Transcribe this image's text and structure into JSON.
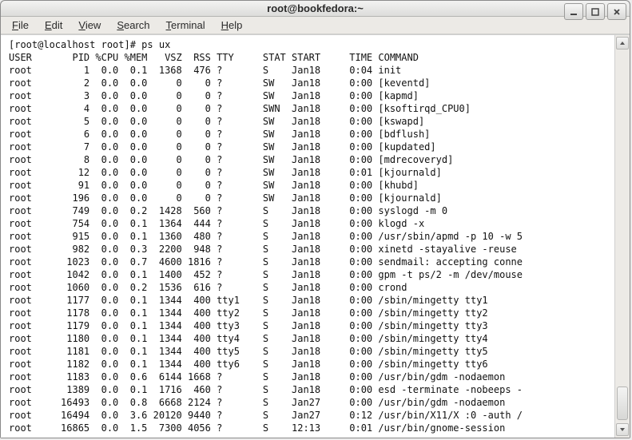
{
  "window": {
    "title": "root@bookfedora:~"
  },
  "menu": {
    "items": [
      {
        "u": "F",
        "rest": "ile"
      },
      {
        "u": "E",
        "rest": "dit"
      },
      {
        "u": "V",
        "rest": "iew"
      },
      {
        "u": "S",
        "rest": "earch"
      },
      {
        "u": "T",
        "rest": "erminal"
      },
      {
        "u": "H",
        "rest": "elp"
      }
    ]
  },
  "terminal": {
    "prompt": "[root@localhost root]# ",
    "cmd": "ps ux",
    "header": [
      "USER",
      "PID",
      "%CPU",
      "%MEM",
      "VSZ",
      "RSS",
      "TTY",
      "STAT",
      "START",
      "TIME",
      "COMMAND"
    ],
    "rows": [
      {
        "user": "root",
        "pid": "1",
        "cpu": "0.0",
        "mem": "0.1",
        "vsz": "1368",
        "rss": "476",
        "tty": "?",
        "stat": "S",
        "start": "Jan18",
        "time": "0:04",
        "cmd": "init"
      },
      {
        "user": "root",
        "pid": "2",
        "cpu": "0.0",
        "mem": "0.0",
        "vsz": "0",
        "rss": "0",
        "tty": "?",
        "stat": "SW",
        "start": "Jan18",
        "time": "0:00",
        "cmd": "[keventd]"
      },
      {
        "user": "root",
        "pid": "3",
        "cpu": "0.0",
        "mem": "0.0",
        "vsz": "0",
        "rss": "0",
        "tty": "?",
        "stat": "SW",
        "start": "Jan18",
        "time": "0:00",
        "cmd": "[kapmd]"
      },
      {
        "user": "root",
        "pid": "4",
        "cpu": "0.0",
        "mem": "0.0",
        "vsz": "0",
        "rss": "0",
        "tty": "?",
        "stat": "SWN",
        "start": "Jan18",
        "time": "0:00",
        "cmd": "[ksoftirqd_CPU0]"
      },
      {
        "user": "root",
        "pid": "5",
        "cpu": "0.0",
        "mem": "0.0",
        "vsz": "0",
        "rss": "0",
        "tty": "?",
        "stat": "SW",
        "start": "Jan18",
        "time": "0:00",
        "cmd": "[kswapd]"
      },
      {
        "user": "root",
        "pid": "6",
        "cpu": "0.0",
        "mem": "0.0",
        "vsz": "0",
        "rss": "0",
        "tty": "?",
        "stat": "SW",
        "start": "Jan18",
        "time": "0:00",
        "cmd": "[bdflush]"
      },
      {
        "user": "root",
        "pid": "7",
        "cpu": "0.0",
        "mem": "0.0",
        "vsz": "0",
        "rss": "0",
        "tty": "?",
        "stat": "SW",
        "start": "Jan18",
        "time": "0:00",
        "cmd": "[kupdated]"
      },
      {
        "user": "root",
        "pid": "8",
        "cpu": "0.0",
        "mem": "0.0",
        "vsz": "0",
        "rss": "0",
        "tty": "?",
        "stat": "SW",
        "start": "Jan18",
        "time": "0:00",
        "cmd": "[mdrecoveryd]"
      },
      {
        "user": "root",
        "pid": "12",
        "cpu": "0.0",
        "mem": "0.0",
        "vsz": "0",
        "rss": "0",
        "tty": "?",
        "stat": "SW",
        "start": "Jan18",
        "time": "0:01",
        "cmd": "[kjournald]"
      },
      {
        "user": "root",
        "pid": "91",
        "cpu": "0.0",
        "mem": "0.0",
        "vsz": "0",
        "rss": "0",
        "tty": "?",
        "stat": "SW",
        "start": "Jan18",
        "time": "0:00",
        "cmd": "[khubd]"
      },
      {
        "user": "root",
        "pid": "196",
        "cpu": "0.0",
        "mem": "0.0",
        "vsz": "0",
        "rss": "0",
        "tty": "?",
        "stat": "SW",
        "start": "Jan18",
        "time": "0:00",
        "cmd": "[kjournald]"
      },
      {
        "user": "root",
        "pid": "749",
        "cpu": "0.0",
        "mem": "0.2",
        "vsz": "1428",
        "rss": "560",
        "tty": "?",
        "stat": "S",
        "start": "Jan18",
        "time": "0:00",
        "cmd": "syslogd -m 0"
      },
      {
        "user": "root",
        "pid": "754",
        "cpu": "0.0",
        "mem": "0.1",
        "vsz": "1364",
        "rss": "444",
        "tty": "?",
        "stat": "S",
        "start": "Jan18",
        "time": "0:00",
        "cmd": "klogd -x"
      },
      {
        "user": "root",
        "pid": "915",
        "cpu": "0.0",
        "mem": "0.1",
        "vsz": "1360",
        "rss": "480",
        "tty": "?",
        "stat": "S",
        "start": "Jan18",
        "time": "0:00",
        "cmd": "/usr/sbin/apmd -p 10 -w 5"
      },
      {
        "user": "root",
        "pid": "982",
        "cpu": "0.0",
        "mem": "0.3",
        "vsz": "2200",
        "rss": "948",
        "tty": "?",
        "stat": "S",
        "start": "Jan18",
        "time": "0:00",
        "cmd": "xinetd -stayalive -reuse"
      },
      {
        "user": "root",
        "pid": "1023",
        "cpu": "0.0",
        "mem": "0.7",
        "vsz": "4600",
        "rss": "1816",
        "tty": "?",
        "stat": "S",
        "start": "Jan18",
        "time": "0:00",
        "cmd": "sendmail: accepting conne"
      },
      {
        "user": "root",
        "pid": "1042",
        "cpu": "0.0",
        "mem": "0.1",
        "vsz": "1400",
        "rss": "452",
        "tty": "?",
        "stat": "S",
        "start": "Jan18",
        "time": "0:00",
        "cmd": "gpm -t ps/2 -m /dev/mouse"
      },
      {
        "user": "root",
        "pid": "1060",
        "cpu": "0.0",
        "mem": "0.2",
        "vsz": "1536",
        "rss": "616",
        "tty": "?",
        "stat": "S",
        "start": "Jan18",
        "time": "0:00",
        "cmd": "crond"
      },
      {
        "user": "root",
        "pid": "1177",
        "cpu": "0.0",
        "mem": "0.1",
        "vsz": "1344",
        "rss": "400",
        "tty": "tty1",
        "stat": "S",
        "start": "Jan18",
        "time": "0:00",
        "cmd": "/sbin/mingetty tty1"
      },
      {
        "user": "root",
        "pid": "1178",
        "cpu": "0.0",
        "mem": "0.1",
        "vsz": "1344",
        "rss": "400",
        "tty": "tty2",
        "stat": "S",
        "start": "Jan18",
        "time": "0:00",
        "cmd": "/sbin/mingetty tty2"
      },
      {
        "user": "root",
        "pid": "1179",
        "cpu": "0.0",
        "mem": "0.1",
        "vsz": "1344",
        "rss": "400",
        "tty": "tty3",
        "stat": "S",
        "start": "Jan18",
        "time": "0:00",
        "cmd": "/sbin/mingetty tty3"
      },
      {
        "user": "root",
        "pid": "1180",
        "cpu": "0.0",
        "mem": "0.1",
        "vsz": "1344",
        "rss": "400",
        "tty": "tty4",
        "stat": "S",
        "start": "Jan18",
        "time": "0:00",
        "cmd": "/sbin/mingetty tty4"
      },
      {
        "user": "root",
        "pid": "1181",
        "cpu": "0.0",
        "mem": "0.1",
        "vsz": "1344",
        "rss": "400",
        "tty": "tty5",
        "stat": "S",
        "start": "Jan18",
        "time": "0:00",
        "cmd": "/sbin/mingetty tty5"
      },
      {
        "user": "root",
        "pid": "1182",
        "cpu": "0.0",
        "mem": "0.1",
        "vsz": "1344",
        "rss": "400",
        "tty": "tty6",
        "stat": "S",
        "start": "Jan18",
        "time": "0:00",
        "cmd": "/sbin/mingetty tty6"
      },
      {
        "user": "root",
        "pid": "1183",
        "cpu": "0.0",
        "mem": "0.6",
        "vsz": "6144",
        "rss": "1668",
        "tty": "?",
        "stat": "S",
        "start": "Jan18",
        "time": "0:00",
        "cmd": "/usr/bin/gdm -nodaemon"
      },
      {
        "user": "root",
        "pid": "1389",
        "cpu": "0.0",
        "mem": "0.1",
        "vsz": "1716",
        "rss": "460",
        "tty": "?",
        "stat": "S",
        "start": "Jan18",
        "time": "0:00",
        "cmd": "esd -terminate -nobeeps -"
      },
      {
        "user": "root",
        "pid": "16493",
        "cpu": "0.0",
        "mem": "0.8",
        "vsz": "6668",
        "rss": "2124",
        "tty": "?",
        "stat": "S",
        "start": "Jan27",
        "time": "0:00",
        "cmd": "/usr/bin/gdm -nodaemon"
      },
      {
        "user": "root",
        "pid": "16494",
        "cpu": "0.0",
        "mem": "3.6",
        "vsz": "20120",
        "rss": "9440",
        "tty": "?",
        "stat": "S",
        "start": "Jan27",
        "time": "0:12",
        "cmd": "/usr/bin/X11/X :0 -auth /"
      },
      {
        "user": "root",
        "pid": "16865",
        "cpu": "0.0",
        "mem": "1.5",
        "vsz": "7300",
        "rss": "4056",
        "tty": "?",
        "stat": "S",
        "start": "12:13",
        "time": "0:01",
        "cmd": "/usr/bin/gnome-session"
      }
    ]
  }
}
